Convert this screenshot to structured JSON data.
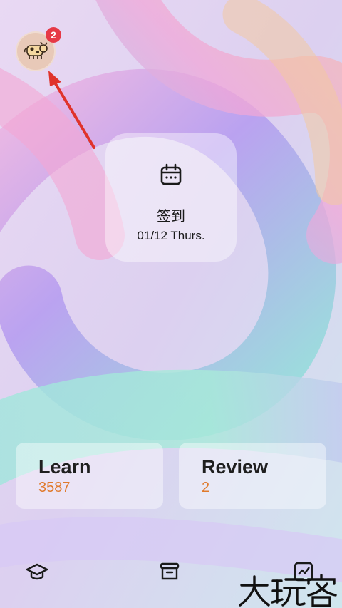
{
  "avatar": {
    "badge_count": "2"
  },
  "checkin": {
    "title": "签到",
    "date": "01/12 Thurs."
  },
  "stats": {
    "learn": {
      "label": "Learn",
      "value": "3587"
    },
    "review": {
      "label": "Review",
      "value": "2"
    }
  },
  "tabbar": {
    "items": [
      {
        "icon": "graduation-cap-icon"
      },
      {
        "icon": "archive-box-icon"
      },
      {
        "icon": "chart-icon"
      }
    ]
  },
  "watermark": {
    "text": "大玩家"
  },
  "colors": {
    "badge": "#e63946",
    "arrow": "#e0332b",
    "accent_value": "#e07a2c",
    "text": "#1a1a1a"
  }
}
